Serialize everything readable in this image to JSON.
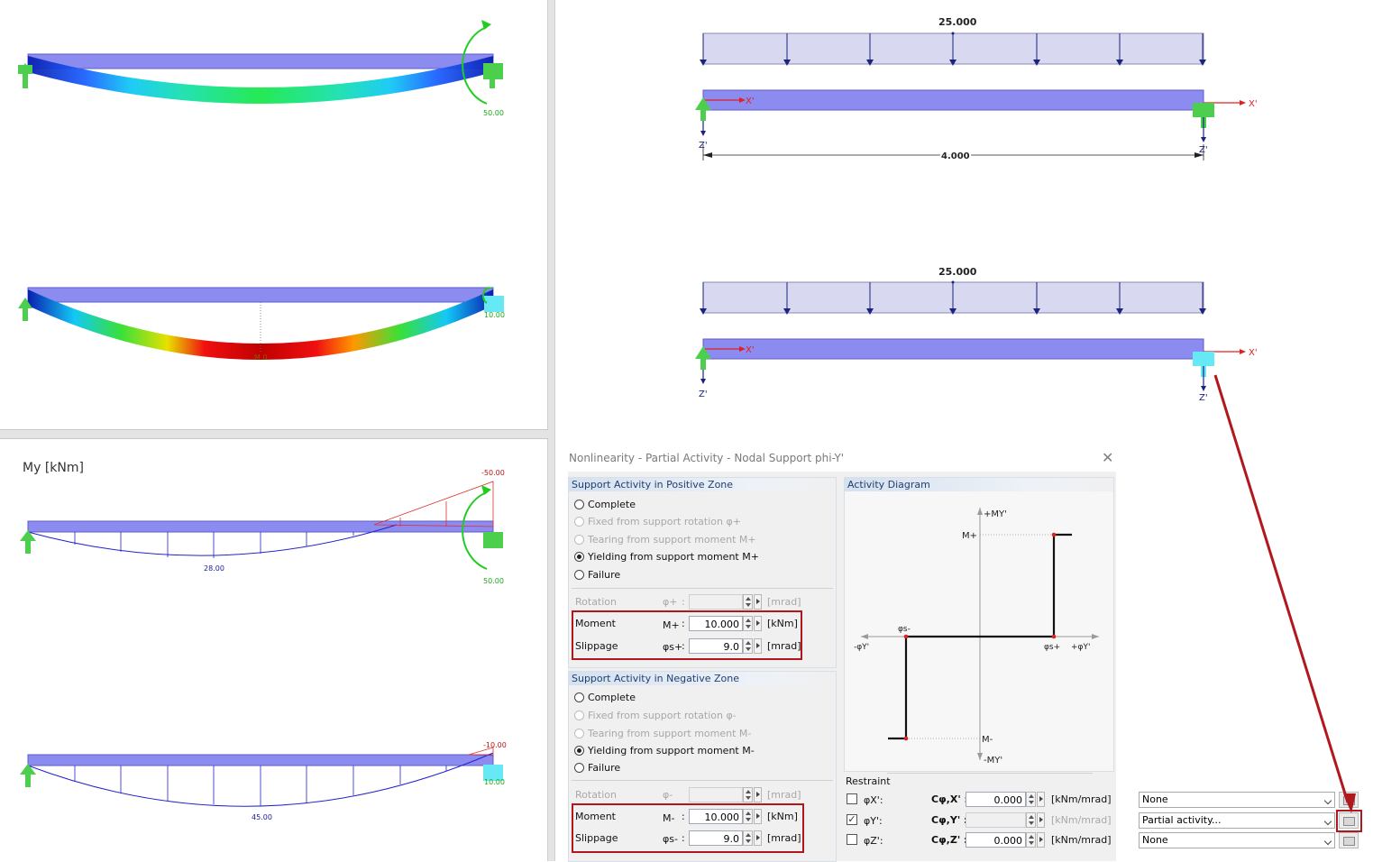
{
  "top_left": {
    "moment_value": "50.00",
    "support_value": "10.00",
    "deflection_label": "M.0"
  },
  "bottom_left": {
    "result_label": "My [kNm]",
    "diagram1": {
      "top_value": "-50.00",
      "field_value": "28.00",
      "support_value": "50.00"
    },
    "diagram2": {
      "top_value": "-10.00",
      "field_value": "45.00",
      "support_value": "10.00"
    }
  },
  "right_model": {
    "load_value_1": "25.000",
    "load_value_2": "25.000",
    "length_value": "4.000",
    "axis_x_left": "X'",
    "axis_x_right": "X'",
    "axis_z_left": "Z'",
    "axis_z_right": "Z'"
  },
  "dialog": {
    "title": "Nonlinearity - Partial Activity - Nodal Support phi-Y'",
    "positive": {
      "header": "Support Activity in Positive Zone",
      "options": [
        {
          "label": "Complete",
          "selected": false,
          "enabled": true
        },
        {
          "label": "Fixed from support rotation φ+",
          "selected": false,
          "enabled": false
        },
        {
          "label": "Tearing from support moment M+",
          "selected": false,
          "enabled": false
        },
        {
          "label": "Yielding from support moment M+",
          "selected": true,
          "enabled": true
        },
        {
          "label": "Failure",
          "selected": false,
          "enabled": true
        }
      ],
      "rotation": {
        "label": "Rotation",
        "symbol": "φ+",
        "colon": ":",
        "value": "",
        "unit": "[mrad]"
      },
      "moment": {
        "label": "Moment",
        "symbol": "M+",
        "colon": ":",
        "value": "10.000",
        "unit": "[kNm]"
      },
      "slippage": {
        "label": "Slippage",
        "symbol": "φs+",
        "colon": ":",
        "value": "9.0",
        "unit": "[mrad]"
      }
    },
    "negative": {
      "header": "Support Activity in Negative Zone",
      "options": [
        {
          "label": "Complete",
          "selected": false,
          "enabled": true
        },
        {
          "label": "Fixed from support rotation φ-",
          "selected": false,
          "enabled": false
        },
        {
          "label": "Tearing from support moment M-",
          "selected": false,
          "enabled": false
        },
        {
          "label": "Yielding from support moment M-",
          "selected": true,
          "enabled": true
        },
        {
          "label": "Failure",
          "selected": false,
          "enabled": true
        }
      ],
      "rotation": {
        "label": "Rotation",
        "symbol": "φ-",
        "colon": ":",
        "value": "",
        "unit": "[mrad]"
      },
      "moment": {
        "label": "Moment",
        "symbol": "M-",
        "colon": ":",
        "value": "10.000",
        "unit": "[kNm]"
      },
      "slippage": {
        "label": "Slippage",
        "symbol": "φs-",
        "colon": ":",
        "value": "9.0",
        "unit": "[mrad]"
      }
    },
    "diagram": {
      "header": "Activity Diagram",
      "axis_top": "+MY'",
      "axis_bottom": "-MY'",
      "axis_left": "-φY'",
      "axis_right": "+φY'",
      "m_plus": "M+",
      "m_minus": "M-",
      "phi_s_plus": "φs+",
      "phi_s_minus": "φs-"
    },
    "restraint": {
      "header": "Restraint",
      "rows": [
        {
          "label": "φX':",
          "checked": false,
          "coef": "Cφ,X' :",
          "value": "0.000",
          "unit": "[kNm/mrad]",
          "option": "None",
          "enabled": true
        },
        {
          "label": "φY':",
          "checked": true,
          "coef": "Cφ,Y' :",
          "value": "",
          "unit": "[kNm/mrad]",
          "option": "Partial activity...",
          "enabled": false
        },
        {
          "label": "φZ':",
          "checked": false,
          "coef": "Cφ,Z' :",
          "value": "0.000",
          "unit": "[kNm/mrad]",
          "option": "None",
          "enabled": true
        }
      ]
    }
  },
  "colors": {
    "beam": "#8c8cf0",
    "load": "#d8d8f0",
    "highlight": "#b0181e",
    "axis_arrow": "#1a237e",
    "support_green": "#4ccf4c",
    "support_cyan": "#33e0f0",
    "moment_green": "#22cc22"
  }
}
